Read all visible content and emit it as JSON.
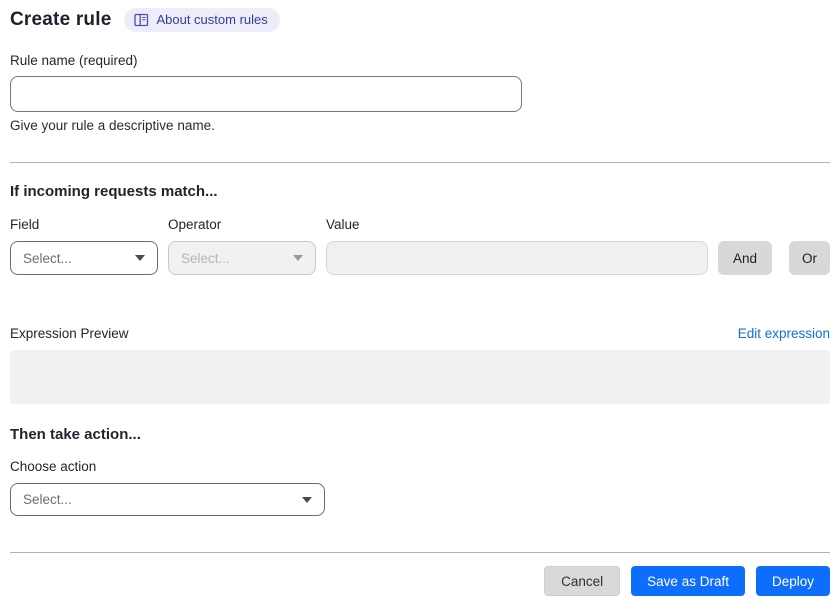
{
  "header": {
    "title": "Create rule",
    "about_link": "About custom rules"
  },
  "rule_name": {
    "label": "Rule name (required)",
    "value": "",
    "helper": "Give your rule a descriptive name."
  },
  "match_section": {
    "heading": "If incoming requests match...",
    "field": {
      "label": "Field",
      "selected": "Select...",
      "enabled": true
    },
    "operator": {
      "label": "Operator",
      "selected": "Select...",
      "enabled": false
    },
    "value": {
      "label": "Value",
      "value": "",
      "enabled": false
    },
    "and_button": "And",
    "or_button": "Or"
  },
  "expression": {
    "label": "Expression Preview",
    "edit_link": "Edit expression",
    "preview_content": ""
  },
  "action_section": {
    "heading": "Then take action...",
    "choose_label": "Choose action",
    "selected": "Select..."
  },
  "footer": {
    "cancel": "Cancel",
    "save_draft": "Save as Draft",
    "deploy": "Deploy"
  },
  "icons": {
    "about_pill": "book-icon",
    "selects": "chevron-down-icon"
  },
  "colors": {
    "primary_button_blue": "#0d6efd",
    "link_blue": "#1270d9",
    "badge_background": "#ededf9",
    "badge_text": "#333d9e",
    "disabled_background": "#f1f1f1",
    "preview_background": "#f1f1f1",
    "gray_button": "#d8d8d8",
    "divider": "#b3b3b3"
  }
}
